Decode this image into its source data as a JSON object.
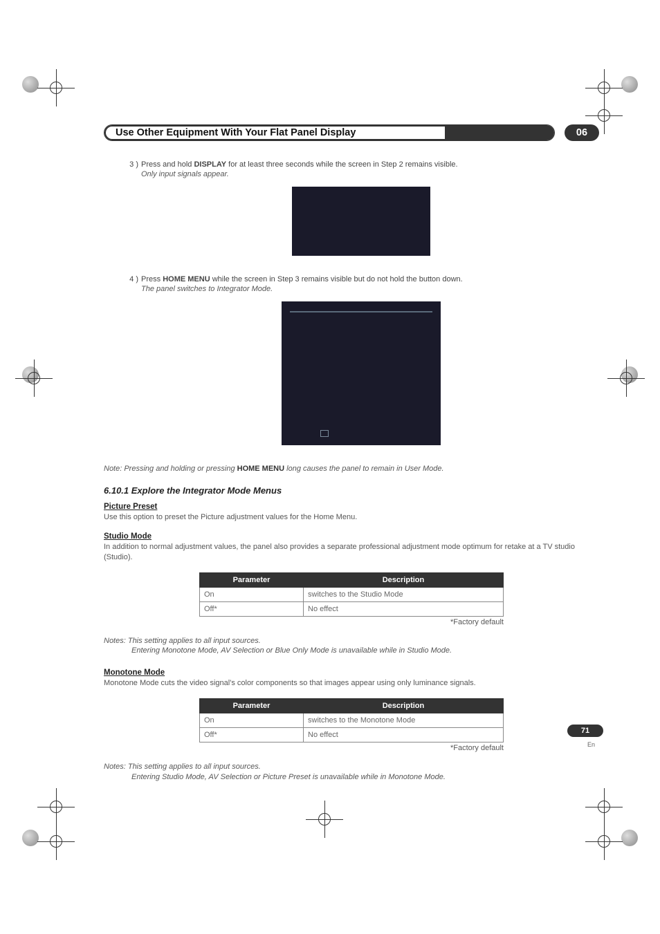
{
  "header": {
    "title": "Use Other Equipment With Your Flat Panel Display",
    "chapter": "06"
  },
  "steps": {
    "s3": {
      "num": "3 )",
      "pre": "Press and hold ",
      "bold": "DISPLAY",
      "post": " for at least three seconds while the screen in Step 2 remains visible.",
      "sub": "Only input signals appear."
    },
    "s4": {
      "num": "4 )",
      "pre": "Press ",
      "bold": "HOME MENU",
      "post": " while the screen in Step 3 remains visible but do not hold the button down.",
      "sub": "The panel switches to Integrator Mode."
    }
  },
  "note1": {
    "pre": "Note: Pressing and holding or pressing ",
    "bold": "HOME MENU",
    "post": " long causes the panel to remain in User Mode."
  },
  "sub_section_title": "6.10.1   Explore the Integrator Mode Menus",
  "picture_preset": {
    "head": "Picture Preset",
    "body": "Use this option to preset the Picture adjustment values for the Home Menu."
  },
  "studio_mode": {
    "head": "Studio Mode",
    "body": "In addition to normal adjustment values, the panel also provides a separate professional adjustment mode optimum for retake at a TV studio (Studio).",
    "table": {
      "h1": "Parameter",
      "h2": "Description",
      "r1c1": "On",
      "r1c2": "switches to the Studio Mode",
      "r2c1": "Off*",
      "r2c2": "No effect"
    },
    "factory": "*Factory default",
    "note_a": "Notes: This setting applies to all input sources.",
    "note_b": "Entering Monotone Mode, AV Selection or Blue Only Mode is unavailable while in Studio Mode."
  },
  "monotone_mode": {
    "head": "Monotone Mode",
    "body": "Monotone Mode cuts the video signal's color components so that images appear using only luminance signals.",
    "table": {
      "h1": "Parameter",
      "h2": "Description",
      "r1c1": "On",
      "r1c2": "switches to the Monotone Mode",
      "r2c1": "Off*",
      "r2c2": "No effect"
    },
    "factory": "*Factory default",
    "note_a": "Notes: This setting applies to all input sources.",
    "note_b": "Entering Studio Mode, AV Selection or Picture Preset is unavailable while in Monotone Mode."
  },
  "footer": {
    "page": "71",
    "lang": "En"
  }
}
